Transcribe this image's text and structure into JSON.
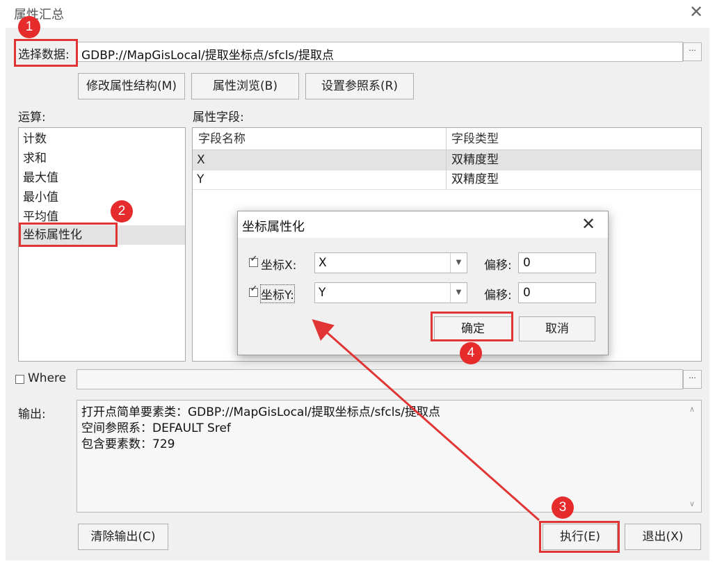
{
  "window": {
    "title": "属性汇总",
    "close_glyph": "✕"
  },
  "select_data": {
    "label": "选择数据:",
    "value": "GDBP://MapGisLocal/提取坐标点/sfcls/提取点",
    "browse_label": "···"
  },
  "toolbar": {
    "modify_structure": "修改属性结构(M)",
    "browse_attributes": "属性浏览(B)",
    "set_reference": "设置参照系(R)"
  },
  "operations": {
    "label": "运算:",
    "items": [
      "计数",
      "求和",
      "最大值",
      "最小值",
      "平均值",
      "坐标属性化"
    ],
    "selected_index": 5
  },
  "fields": {
    "label": "属性字段:",
    "columns": [
      "字段名称",
      "字段类型"
    ],
    "rows": [
      [
        "X",
        "双精度型"
      ],
      [
        "Y",
        "双精度型"
      ]
    ],
    "selected_row": 0
  },
  "where": {
    "label": "Where",
    "checked": false,
    "value": "",
    "browse_label": "···"
  },
  "output": {
    "label": "输出:",
    "lines": [
      "打开点简单要素类：GDBP://MapGisLocal/提取坐标点/sfcls/提取点",
      "空间参照系：DEFAULT Sref",
      "包含要素数：729"
    ]
  },
  "bottom": {
    "clear_output": "清除输出(C)",
    "execute": "执行(E)",
    "exit": "退出(X)"
  },
  "dialog": {
    "title": "坐标属性化",
    "close_glyph": "✕",
    "coord_x_label": "坐标X:",
    "coord_x_checked": true,
    "coord_x_value": "X",
    "offset_x_label": "偏移:",
    "offset_x_value": "0",
    "coord_y_label": "坐标Y:",
    "coord_y_checked": true,
    "coord_y_value": "Y",
    "offset_y_label": "偏移:",
    "offset_y_value": "0",
    "ok": "确定",
    "cancel": "取消"
  },
  "annotations": {
    "step1": "1",
    "step2": "2",
    "step3": "3",
    "step4": "4",
    "color": "#e13434"
  }
}
